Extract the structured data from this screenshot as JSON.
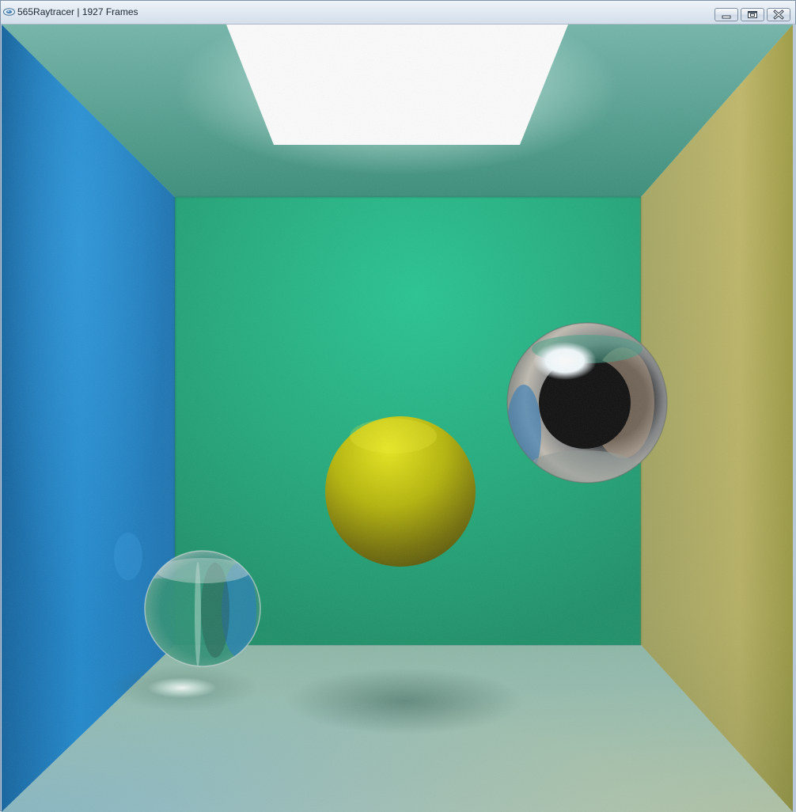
{
  "window": {
    "title": "565Raytracer | 1927 Frames",
    "controls": {
      "minimize_icon": "minimize-icon",
      "maximize_icon": "maximize-icon",
      "close_icon": "close-icon"
    }
  },
  "scene": {
    "description_icon": "render-canvas",
    "colors": {
      "left_wall": "#1a86d0",
      "back_wall": "#1ea876",
      "right_wall": "#b8b056",
      "ceiling": "#4c9c8e",
      "floor": "#8fb8b0",
      "light": "#ffffff",
      "diffuse_sphere": "#c4c400",
      "mirror_sphere": "#a9b0b6",
      "glass_sphere": "#3b9b84"
    }
  }
}
